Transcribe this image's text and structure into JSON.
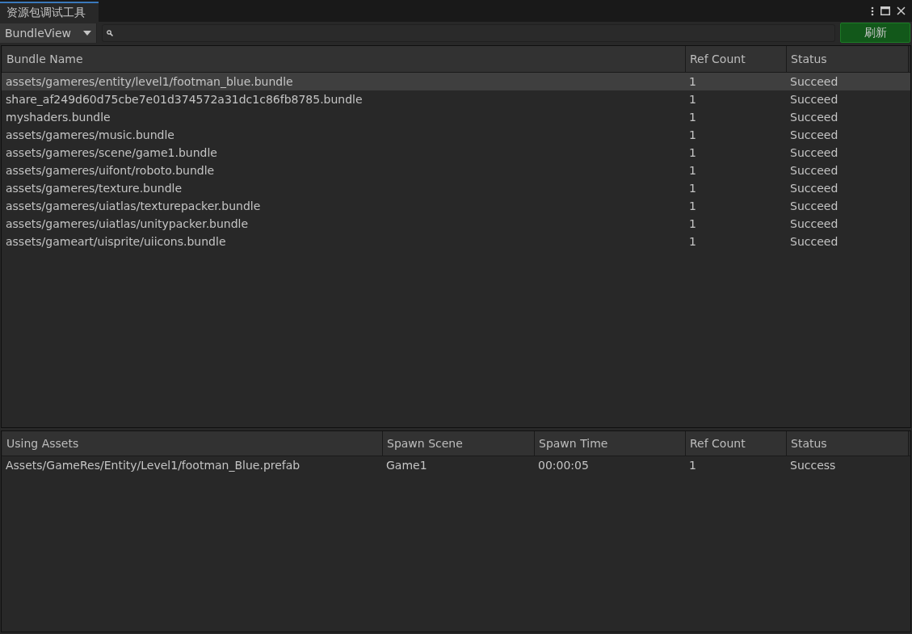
{
  "window": {
    "tab_title": "资源包调试工具"
  },
  "toolbar": {
    "view_dropdown": "BundleView",
    "refresh_button": "刷新"
  },
  "bundle_table": {
    "columns": [
      "Bundle Name",
      "Ref Count",
      "Status"
    ],
    "rows": [
      {
        "cells": [
          "assets/gameres/entity/level1/footman_blue.bundle",
          "1",
          "Succeed"
        ],
        "selected": true
      },
      {
        "cells": [
          "share_af249d60d75cbe7e01d374572a31dc1c86fb8785.bundle",
          "1",
          "Succeed"
        ],
        "selected": false
      },
      {
        "cells": [
          "myshaders.bundle",
          "1",
          "Succeed"
        ],
        "selected": false
      },
      {
        "cells": [
          "assets/gameres/music.bundle",
          "1",
          "Succeed"
        ],
        "selected": false
      },
      {
        "cells": [
          "assets/gameres/scene/game1.bundle",
          "1",
          "Succeed"
        ],
        "selected": false
      },
      {
        "cells": [
          "assets/gameres/uifont/roboto.bundle",
          "1",
          "Succeed"
        ],
        "selected": false
      },
      {
        "cells": [
          "assets/gameres/texture.bundle",
          "1",
          "Succeed"
        ],
        "selected": false
      },
      {
        "cells": [
          "assets/gameres/uiatlas/texturepacker.bundle",
          "1",
          "Succeed"
        ],
        "selected": false
      },
      {
        "cells": [
          "assets/gameres/uiatlas/unitypacker.bundle",
          "1",
          "Succeed"
        ],
        "selected": false
      },
      {
        "cells": [
          "assets/gameart/uisprite/uiicons.bundle",
          "1",
          "Succeed"
        ],
        "selected": false
      }
    ]
  },
  "asset_table": {
    "columns": [
      "Using Assets",
      "Spawn Scene",
      "Spawn Time",
      "Ref Count",
      "Status"
    ],
    "rows": [
      {
        "cells": [
          "Assets/GameRes/Entity/Level1/footman_Blue.prefab",
          "Game1",
          "00:00:05",
          "1",
          "Success"
        ],
        "selected": false
      }
    ]
  }
}
